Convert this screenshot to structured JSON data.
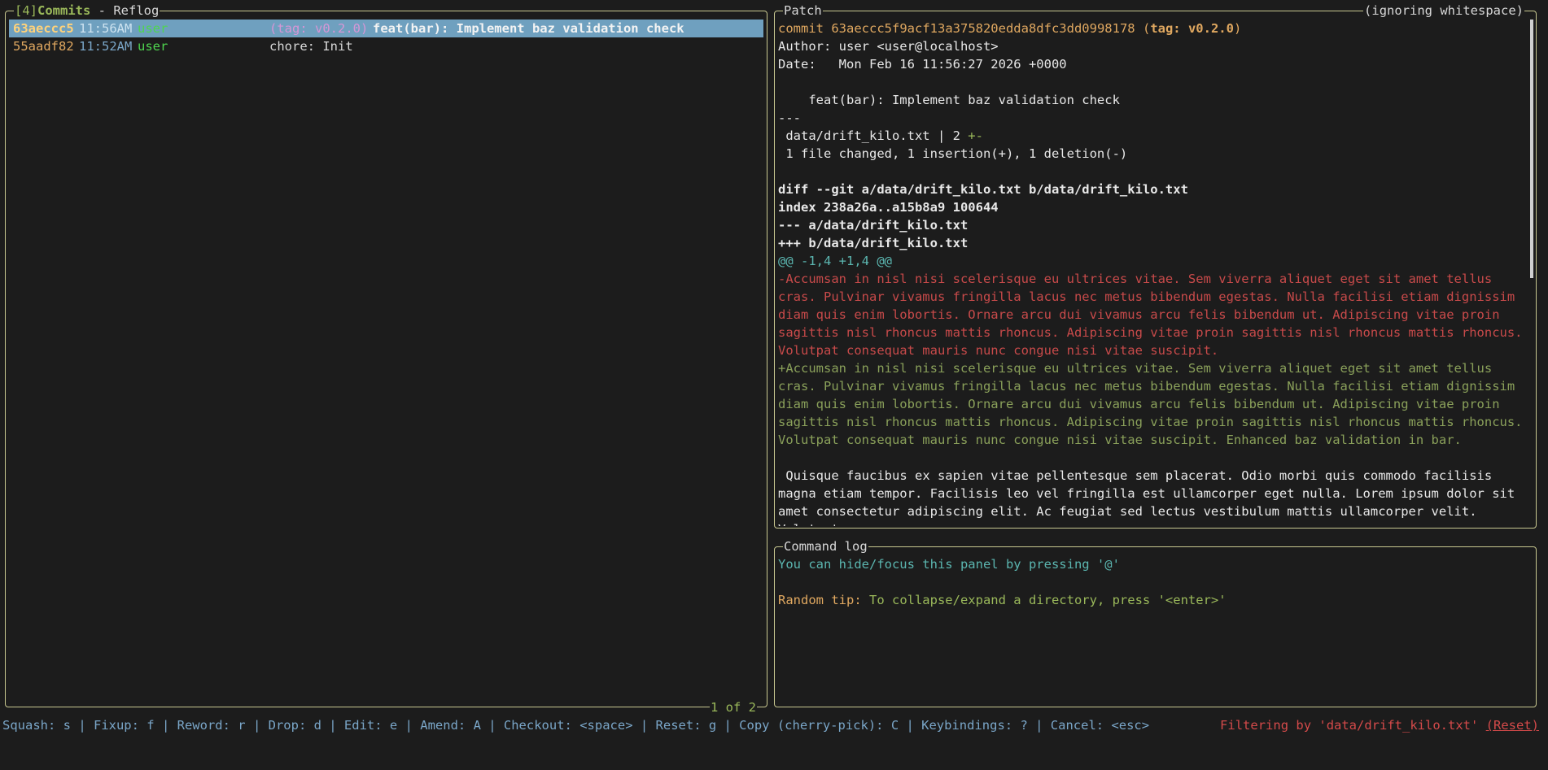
{
  "commits_panel": {
    "title_index": "[4]",
    "title_tab": "Commits",
    "title_sep": " - ",
    "title_sub": "Reflog",
    "position": "1 of 2",
    "rows": [
      {
        "sha": "63aeccc5",
        "time": "11:56AM",
        "author": "user",
        "tag": "(tag: v0.2.0)",
        "message": "feat(bar): Implement baz validation check",
        "selected": true
      },
      {
        "sha": "55aadf82",
        "time": "11:52AM",
        "author": "user",
        "tag": "",
        "message": "chore: Init",
        "selected": false
      }
    ]
  },
  "patch_panel": {
    "title": "Patch",
    "right_title": "(ignoring whitespace)",
    "commit_label": "commit",
    "commit_hash": "63aeccc5f9acf13a375820edda8dfc3dd0998178",
    "tag_open": "(",
    "tag_label": "tag: v0.2.0",
    "tag_close": ")",
    "author_line": "Author: user <user@localhost>",
    "date_line": "Date:   Mon Feb 16 11:56:27 2026 +0000",
    "message_line": "    feat(bar): Implement baz validation check",
    "separator": "---",
    "stat_file": " data/drift_kilo.txt | 2 ",
    "stat_marks": "+-",
    "stat_summary": " 1 file changed, 1 insertion(+), 1 deletion(-)",
    "diff_header": "diff --git a/data/drift_kilo.txt b/data/drift_kilo.txt",
    "index_line": "index 238a26a..a15b8a9 100644",
    "old_file": "--- a/data/drift_kilo.txt",
    "new_file": "+++ b/data/drift_kilo.txt",
    "hunk": "@@ -1,4 +1,4 @@",
    "removed": "-Accumsan in nisl nisi scelerisque eu ultrices vitae. Sem viverra aliquet eget sit amet tellus cras. Pulvinar vivamus fringilla lacus nec metus bibendum egestas. Nulla facilisi etiam dignissim diam quis enim lobortis. Ornare arcu dui vivamus arcu felis bibendum ut. Adipiscing vitae proin sagittis nisl rhoncus mattis rhoncus. Adipiscing vitae proin sagittis nisl rhoncus mattis rhoncus. Volutpat consequat mauris nunc congue nisi vitae suscipit.",
    "added": "+Accumsan in nisl nisi scelerisque eu ultrices vitae. Sem viverra aliquet eget sit amet tellus cras. Pulvinar vivamus fringilla lacus nec metus bibendum egestas. Nulla facilisi etiam dignissim diam quis enim lobortis. Ornare arcu dui vivamus arcu felis bibendum ut. Adipiscing vitae proin sagittis nisl rhoncus mattis rhoncus. Adipiscing vitae proin sagittis nisl rhoncus mattis rhoncus. Volutpat consequat mauris nunc congue nisi vitae suscipit. Enhanced baz validation in bar.",
    "context": " Quisque faucibus ex sapien vitae pellentesque sem placerat. Odio morbi quis commodo facilisis magna etiam tempor. Facilisis leo vel fringilla est ullamcorper eget nulla. Lorem ipsum dolor sit amet consectetur adipiscing elit. Ac feugiat sed lectus vestibulum mattis ullamcorper velit. Volutpat"
  },
  "command_log": {
    "title": "Command log",
    "hint": "You can hide/focus this panel by pressing '@'",
    "tip_label": "Random tip:",
    "tip_text": " To collapse/expand a directory, press '<enter>'"
  },
  "status_bar": {
    "keybindings": "Squash: s | Fixup: f | Reword: r | Drop: d | Edit: e | Amend: A | Checkout: <space> | Reset: g | Copy (cherry-pick): C | Keybindings: ? | Cancel: <esc>",
    "filter_text": "Filtering by 'data/drift_kilo.txt' ",
    "reset_label": "(Reset)"
  },
  "colors": {
    "border": "#c8c890",
    "selection": "#6fa0bf",
    "removed": "#c84a4a",
    "added": "#9ab85a",
    "hunk": "#5bb6b0",
    "sha": "#e0a860"
  }
}
